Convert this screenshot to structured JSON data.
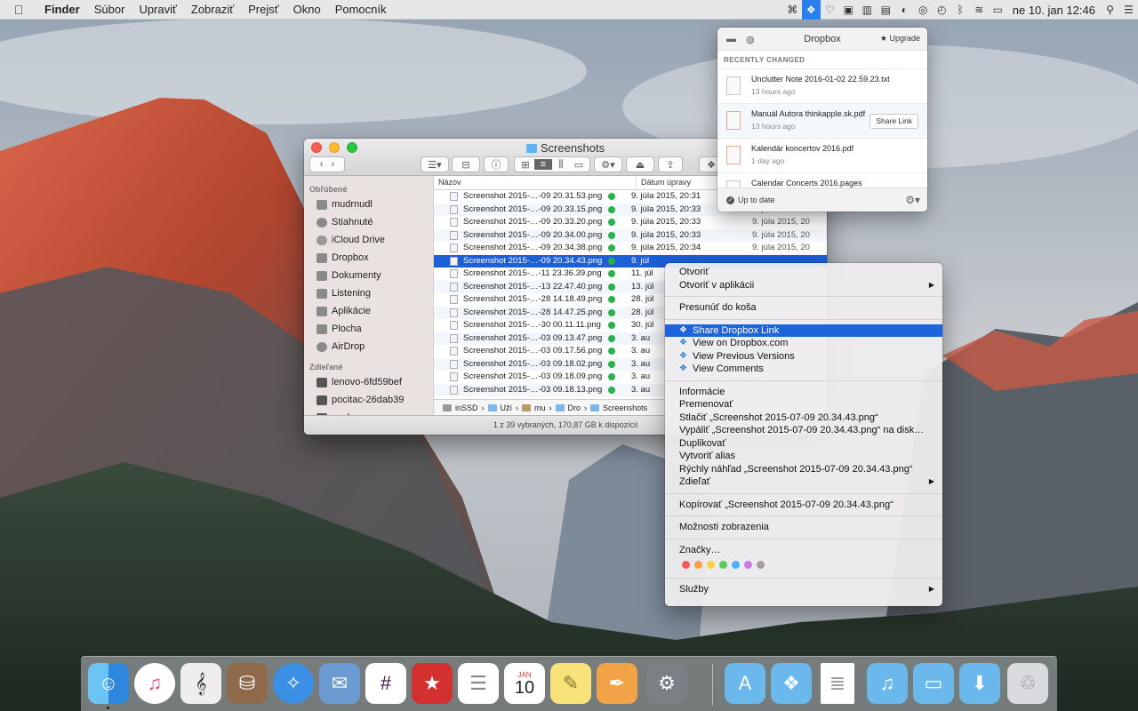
{
  "menubar": {
    "apple_icon": "apple-logo-icon",
    "app_name": "Finder",
    "menus": [
      "Súbor",
      "Upraviť",
      "Zobraziť",
      "Prejsť",
      "Okno",
      "Pomocník"
    ],
    "status_icons": [
      "command-icon",
      "dropbox-icon",
      "heart-icon",
      "bag-icon",
      "trash-status-icon",
      "inbox-icon",
      "toggle-icon",
      "sync-icon",
      "time-machine-icon",
      "bluetooth-icon",
      "wifi-icon",
      "battery-icon"
    ],
    "clock": "ne 10. jan  12:46",
    "search_icon": "spotlight-icon",
    "list_icon": "notification-center-icon"
  },
  "finder": {
    "title": "Screenshots",
    "sidebar": {
      "favorites_label": "Obľúbené",
      "favorites": [
        "mudrnudl",
        "Stiahnuté",
        "iCloud Drive",
        "Dropbox",
        "Dokumenty",
        "Listening",
        "Aplikácie",
        "Plocha",
        "AirDrop"
      ],
      "shared_label": "Zdieľané",
      "shared": [
        "lenovo-6fd59bef",
        "pocitac-26dab39",
        "workgroup"
      ]
    },
    "columns": {
      "name": "Názov",
      "date": "Dátum úpravy"
    },
    "rows": [
      {
        "name": "Screenshot 2015-…-09 20.31.53.png",
        "date": "9. júla 2015, 20:31",
        "date2": ""
      },
      {
        "name": "Screenshot 2015-…-09 20.33.15.png",
        "date": "9. júla 2015, 20:33",
        "date2": "9. júla 2015, 20"
      },
      {
        "name": "Screenshot 2015-…-09 20.33.20.png",
        "date": "9. júla 2015, 20:33",
        "date2": "9. júla 2015, 20"
      },
      {
        "name": "Screenshot 2015-…-09 20.34.00.png",
        "date": "9. júla 2015, 20:33",
        "date2": "9. júla 2015, 20"
      },
      {
        "name": "Screenshot 2015-…-09 20.34.38.png",
        "date": "9. júla 2015, 20:34",
        "date2": "9. júla 2015, 20"
      },
      {
        "name": "Screenshot 2015-…-09 20.34.43.png",
        "date": "9. júl",
        "date2": "",
        "selected": true
      },
      {
        "name": "Screenshot 2015-…-11 23.36.39.png",
        "date": "11. júl",
        "date2": ""
      },
      {
        "name": "Screenshot 2015-…-13 22.47.40.png",
        "date": "13. júl",
        "date2": ""
      },
      {
        "name": "Screenshot 2015-…-28 14.18.49.png",
        "date": "28. júl",
        "date2": ""
      },
      {
        "name": "Screenshot 2015-…-28 14.47.25.png",
        "date": "28. júl",
        "date2": ""
      },
      {
        "name": "Screenshot 2015-…-30 00.11.11.png",
        "date": "30. júl",
        "date2": ""
      },
      {
        "name": "Screenshot 2015-…-03 09.13.47.png",
        "date": "3. au",
        "date2": ""
      },
      {
        "name": "Screenshot 2015-…-03 09.17.56.png",
        "date": "3. au",
        "date2": ""
      },
      {
        "name": "Screenshot 2015-…-03 09.18.02.png",
        "date": "3. au",
        "date2": ""
      },
      {
        "name": "Screenshot 2015-…-03 09.18.09.png",
        "date": "3. au",
        "date2": ""
      },
      {
        "name": "Screenshot 2015-…-03 09.18.13.png",
        "date": "3. au",
        "date2": ""
      }
    ],
    "path": [
      "inSSD",
      "Uží",
      "mu",
      "Dro",
      "Screenshots"
    ],
    "status": "1 z 39 vybraných, 170,87 GB k dispozícii"
  },
  "dropbox": {
    "title": "Dropbox",
    "upgrade": "Upgrade",
    "recent_label": "RECENTLY CHANGED",
    "items": [
      {
        "name": "Unclutter Note 2016-01-02 22.59.23.txt",
        "time": "13 hours ago"
      },
      {
        "name": "Manuál Autora thinkapple.sk.pdf",
        "time": "13 hours ago"
      },
      {
        "name": "Kalendár koncertov 2016.pdf",
        "time": "1 day ago"
      },
      {
        "name": "Calendar Concerts 2016.pages",
        "time": ""
      }
    ],
    "share_link": "Share Link",
    "status": "Up to date"
  },
  "context_menu": {
    "open": "Otvoriť",
    "open_with": "Otvoriť v aplikácii",
    "move_to_trash": "Presunúť do koša",
    "share_dropbox_link": "Share Dropbox Link",
    "view_on_dropbox": "View on Dropbox.com",
    "view_versions": "View Previous Versions",
    "view_comments": "View Comments",
    "info": "Informácie",
    "rename": "Premenovať",
    "compress": "Stlačiť „Screenshot 2015-07-09 20.34.43.png“",
    "burn": "Vypáliť „Screenshot 2015-07-09 20.34.43.png“ na disk…",
    "duplicate": "Duplikovať",
    "alias": "Vytvoriť alias",
    "quicklook": "Rýchly náhľad „Screenshot 2015-07-09 20.34.43.png“",
    "share": "Zdieľať",
    "copy": "Kopírovať „Screenshot 2015-07-09 20.34.43.png“",
    "view_options": "Možnosti zobrazenia",
    "tags": "Značky…",
    "tag_colors": [
      "#f25a5a",
      "#f5a34a",
      "#f5d24a",
      "#5ccb59",
      "#4cb1f0",
      "#c77de0",
      "#a0a0a0"
    ],
    "services": "Služby"
  },
  "dock": {
    "apps": [
      "finder-icon",
      "itunes-icon",
      "musescore-icon",
      "unarchiver-icon",
      "safari-icon",
      "mail-icon",
      "slack-icon",
      "wunderlist-icon",
      "reminders-icon",
      "calendar-icon",
      "notes-icon",
      "pages-icon",
      "system-preferences-icon"
    ],
    "calendar_month": "JAN",
    "calendar_day": "10",
    "stacks": [
      "applications-stack-icon",
      "dropbox-stack-icon",
      "document-stack-icon",
      "music-stack-icon",
      "folder-stack-icon",
      "downloads-stack-icon",
      "trash-icon"
    ]
  }
}
